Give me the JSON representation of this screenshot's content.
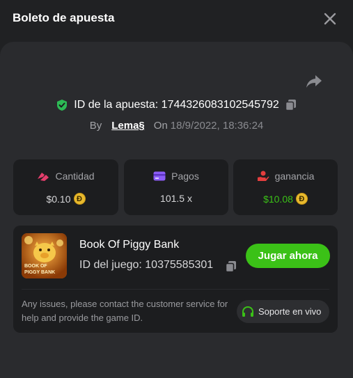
{
  "header": {
    "title": "Boleto de apuesta"
  },
  "bet": {
    "id_label": "ID de la apuesta: 1744326083102545792",
    "by_label": "By",
    "user": "Lema§",
    "on_label": "On",
    "date": "18/9/2022, 18:36:24"
  },
  "stats": [
    {
      "label": "Cantidad",
      "value": "$0.10",
      "icon": "bet-amount-icon",
      "coin": true
    },
    {
      "label": "Pagos",
      "value": "101.5 x",
      "icon": "payout-card-icon",
      "coin": false
    },
    {
      "label": "ganancia",
      "value": "$10.08",
      "icon": "profit-hand-icon",
      "coin": true
    }
  ],
  "coin_symbol": "Đ",
  "game": {
    "name": "Book Of Piggy Bank",
    "id_label": "ID del juego: 10375585301",
    "thumb_text_1": "BOOK OF",
    "thumb_text_2": "PIGGY BANK",
    "play_label": "Jugar ahora",
    "help_text": "Any issues, please contact the customer service for help and provide the game ID.",
    "support_label": "Soporte en vivo"
  },
  "colors": {
    "accent_green": "#3bc117",
    "profit_green": "#3bc117",
    "coin_gold": "#e8b92d",
    "verified_green": "#2dbb55"
  }
}
